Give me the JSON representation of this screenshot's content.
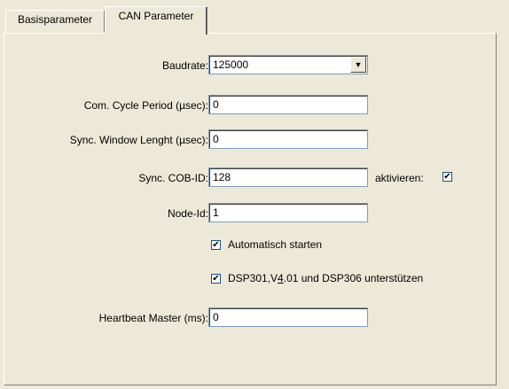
{
  "tabs": [
    {
      "label": "Basisparameter"
    },
    {
      "label": "CAN Parameter"
    }
  ],
  "form": {
    "baudrate": {
      "label": "Baudrate:",
      "value": "125000"
    },
    "com_cycle": {
      "label": "Com. Cycle Period (µsec):",
      "value": "0"
    },
    "sync_window": {
      "label": "Sync. Window Lenght (µsec):",
      "value": "0"
    },
    "sync_cob_id": {
      "label": "Sync. COB-ID:",
      "value": "128"
    },
    "aktivieren": {
      "label": "aktivieren:",
      "checked": true
    },
    "node_id": {
      "label": "Node-Id:",
      "value": "1"
    },
    "auto_start": {
      "label": "Automatisch starten",
      "checked": true
    },
    "dsp": {
      "label_pre": "DSP301,V",
      "label_u": "4",
      "label_post": ".01 und DSP306 unterstützen",
      "checked": true
    },
    "heartbeat": {
      "label": "Heartbeat Master (ms):",
      "value": "0"
    }
  },
  "icons": {
    "dropdown": "chevron-down-icon",
    "check": "checkmark-icon"
  }
}
